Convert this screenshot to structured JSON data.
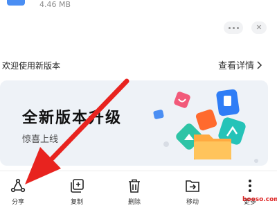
{
  "file": {
    "size": "4.46 MB"
  },
  "actions": {
    "more_icon": "dots-icon",
    "close_symbol": "✕"
  },
  "whats_new": {
    "title": "欢迎使用新版本",
    "link": "查看详情"
  },
  "banner": {
    "title": "全新版本升级",
    "subtitle": "惊喜上线"
  },
  "toolbar": {
    "share": "分享",
    "copy": "复制",
    "delete": "删除",
    "move": "移动",
    "more": "更多"
  },
  "watermark": "booso.com",
  "colors": {
    "annotation_arrow": "#e8231f",
    "accent_blue": "#4a8ef3"
  }
}
